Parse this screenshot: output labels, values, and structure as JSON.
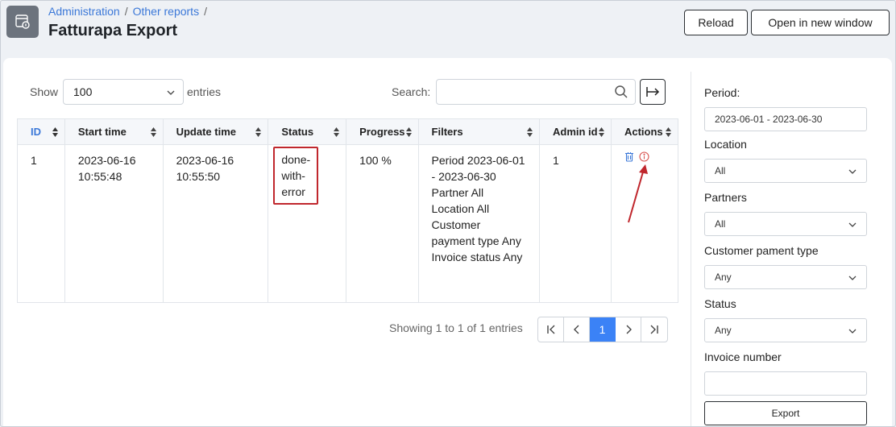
{
  "header": {
    "breadcrumb": [
      "Administration",
      "Other reports"
    ],
    "title": "Fatturapa Export",
    "reload_label": "Reload",
    "open_new_window_label": "Open in new window"
  },
  "table_controls": {
    "show_label": "Show",
    "entries_value": "100",
    "entries_label": "entries",
    "search_label": "Search:",
    "search_value": ""
  },
  "table": {
    "columns": [
      "ID",
      "Start time",
      "Update time",
      "Status",
      "Progress",
      "Filters",
      "Admin id",
      "Actions"
    ],
    "rows": [
      {
        "id": "1",
        "start_time": "2023-06-16 10:55:48",
        "update_time": "2023-06-16 10:55:50",
        "status": "done-with-error",
        "progress": "100 %",
        "filters": "Period 2023-06-01 - 2023-06-30 Partner All Location All Customer payment type Any Invoice status Any",
        "admin_id": "1",
        "actions": [
          "trash-icon",
          "info-icon"
        ]
      }
    ]
  },
  "pagination": {
    "info": "Showing 1 to 1 of 1 entries",
    "current_page": "1"
  },
  "filters_form": {
    "period_label": "Period:",
    "period_value": "2023-06-01 - 2023-06-30",
    "location_label": "Location",
    "location_value": "All",
    "partners_label": "Partners",
    "partners_value": "All",
    "payment_type_label": "Customer pament type",
    "payment_type_value": "Any",
    "status_label": "Status",
    "status_value": "Any",
    "invoice_number_label": "Invoice number",
    "invoice_number_value": "",
    "export_label": "Export"
  },
  "colors": {
    "accent": "#3b82f6",
    "link": "#3b78d8",
    "highlight": "#c0272d",
    "icon_grey": "#6c737d"
  }
}
